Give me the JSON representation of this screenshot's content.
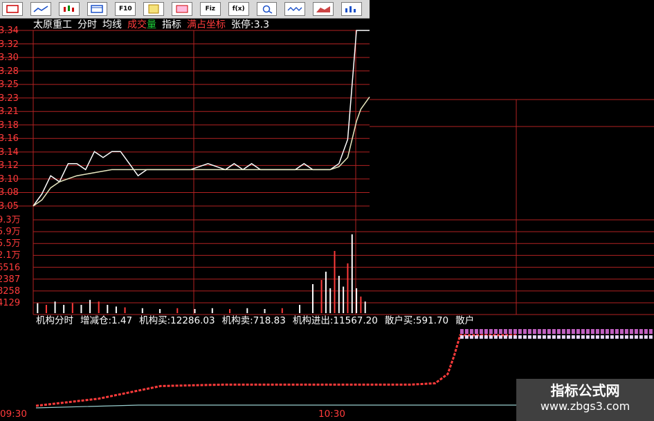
{
  "toolbar": {
    "buttons": [
      {
        "name": "select-icon",
        "label": ""
      },
      {
        "name": "line-chart-icon",
        "label": ""
      },
      {
        "name": "candlestick-icon",
        "label": ""
      },
      {
        "name": "window-icon",
        "label": ""
      },
      {
        "name": "f10-icon",
        "label": "F10"
      },
      {
        "name": "notes-icon",
        "label": ""
      },
      {
        "name": "red-frame-icon",
        "label": ""
      },
      {
        "name": "formula-icon",
        "label": "Fiz"
      },
      {
        "name": "fx-icon",
        "label": "f(x)"
      },
      {
        "name": "zoom-icon",
        "label": ""
      },
      {
        "name": "wave-icon",
        "label": ""
      },
      {
        "name": "area-icon",
        "label": ""
      },
      {
        "name": "bars-icon",
        "label": ""
      }
    ]
  },
  "header": {
    "stock": "太原重工",
    "items": [
      "分时",
      "均线"
    ],
    "volume_a": "成交",
    "volume_b": "量",
    "indicator": "指标",
    "coord": "满占坐标",
    "limit": "张停:3.3"
  },
  "price_axis": [
    "3.34",
    "3.32",
    "3.30",
    "3.28",
    "3.25",
    "3.23",
    "3.21",
    "3.18",
    "3.16",
    "3.14",
    "3.12",
    "3.10",
    "3.08",
    "3.05"
  ],
  "volume_axis": [
    "9.3万",
    "5.9万",
    "5.5万",
    "2.1万",
    "6516",
    "2387",
    "8258",
    "4129"
  ],
  "time_axis": [
    "09:30",
    "10:30"
  ],
  "indicator_bar": {
    "name": "机构分时",
    "items": [
      "增减仓:1.47",
      "机构买:12286.03",
      "机构卖:718.83",
      "机构进出:11567.20",
      "散户买:591.70",
      "散户"
    ]
  },
  "watermark": {
    "title": "指标公式网",
    "url": "www.zbgs3.com"
  },
  "colors": {
    "grid": "#b22222",
    "price": "#ffffff",
    "avg": "#e8e8c0",
    "up": "#ff3b3b",
    "accent": "#ff3b3b"
  },
  "chart_data": {
    "type": "line",
    "title": "",
    "xlabel": "",
    "ylabel": "",
    "x_range": [
      "09:30",
      "10:47"
    ],
    "ylim": [
      3.05,
      3.34
    ],
    "series": [
      {
        "kind": "price",
        "x": [
          0,
          2,
          4,
          6,
          8,
          10,
          12,
          14,
          16,
          18,
          20,
          22,
          24,
          26,
          28,
          30,
          32,
          34,
          36,
          40,
          44,
          46,
          48,
          50,
          52,
          54,
          56,
          58,
          60,
          62,
          64,
          66,
          68,
          70,
          72,
          74,
          76,
          77
        ],
        "values": [
          3.05,
          3.07,
          3.1,
          3.09,
          3.12,
          3.12,
          3.11,
          3.14,
          3.13,
          3.14,
          3.14,
          3.12,
          3.1,
          3.11,
          3.11,
          3.11,
          3.11,
          3.11,
          3.11,
          3.12,
          3.11,
          3.12,
          3.11,
          3.12,
          3.11,
          3.11,
          3.11,
          3.11,
          3.11,
          3.12,
          3.11,
          3.11,
          3.11,
          3.12,
          3.16,
          3.34,
          3.34,
          3.34
        ]
      },
      {
        "kind": "average",
        "x": [
          0,
          2,
          4,
          6,
          8,
          10,
          14,
          18,
          22,
          26,
          30,
          40,
          50,
          60,
          68,
          70,
          72,
          74,
          75,
          76,
          77
        ],
        "values": [
          3.05,
          3.06,
          3.08,
          3.09,
          3.095,
          3.1,
          3.105,
          3.11,
          3.11,
          3.11,
          3.11,
          3.11,
          3.11,
          3.11,
          3.11,
          3.115,
          3.13,
          3.19,
          3.21,
          3.22,
          3.23
        ]
      }
    ],
    "volume": {
      "x": [
        1,
        3,
        5,
        7,
        9,
        11,
        13,
        15,
        17,
        19,
        21,
        25,
        29,
        33,
        37,
        41,
        45,
        49,
        53,
        57,
        61,
        64,
        66,
        67,
        68,
        69,
        70,
        71,
        72,
        73,
        74,
        75,
        76
      ],
      "values": [
        0.12,
        0.1,
        0.14,
        0.1,
        0.12,
        0.1,
        0.16,
        0.14,
        0.1,
        0.08,
        0.07,
        0.06,
        0.05,
        0.06,
        0.05,
        0.06,
        0.05,
        0.06,
        0.05,
        0.06,
        0.1,
        0.35,
        0.4,
        0.5,
        0.3,
        0.75,
        0.45,
        0.32,
        0.6,
        0.95,
        0.3,
        0.2,
        0.14
      ]
    },
    "indicator": {
      "x": [
        0,
        10,
        20,
        30,
        40,
        50,
        60,
        64,
        66,
        67,
        68,
        77
      ],
      "values": [
        0.0,
        0.1,
        0.28,
        0.3,
        0.3,
        0.3,
        0.3,
        0.32,
        0.45,
        0.7,
        1.0,
        1.0
      ]
    }
  }
}
